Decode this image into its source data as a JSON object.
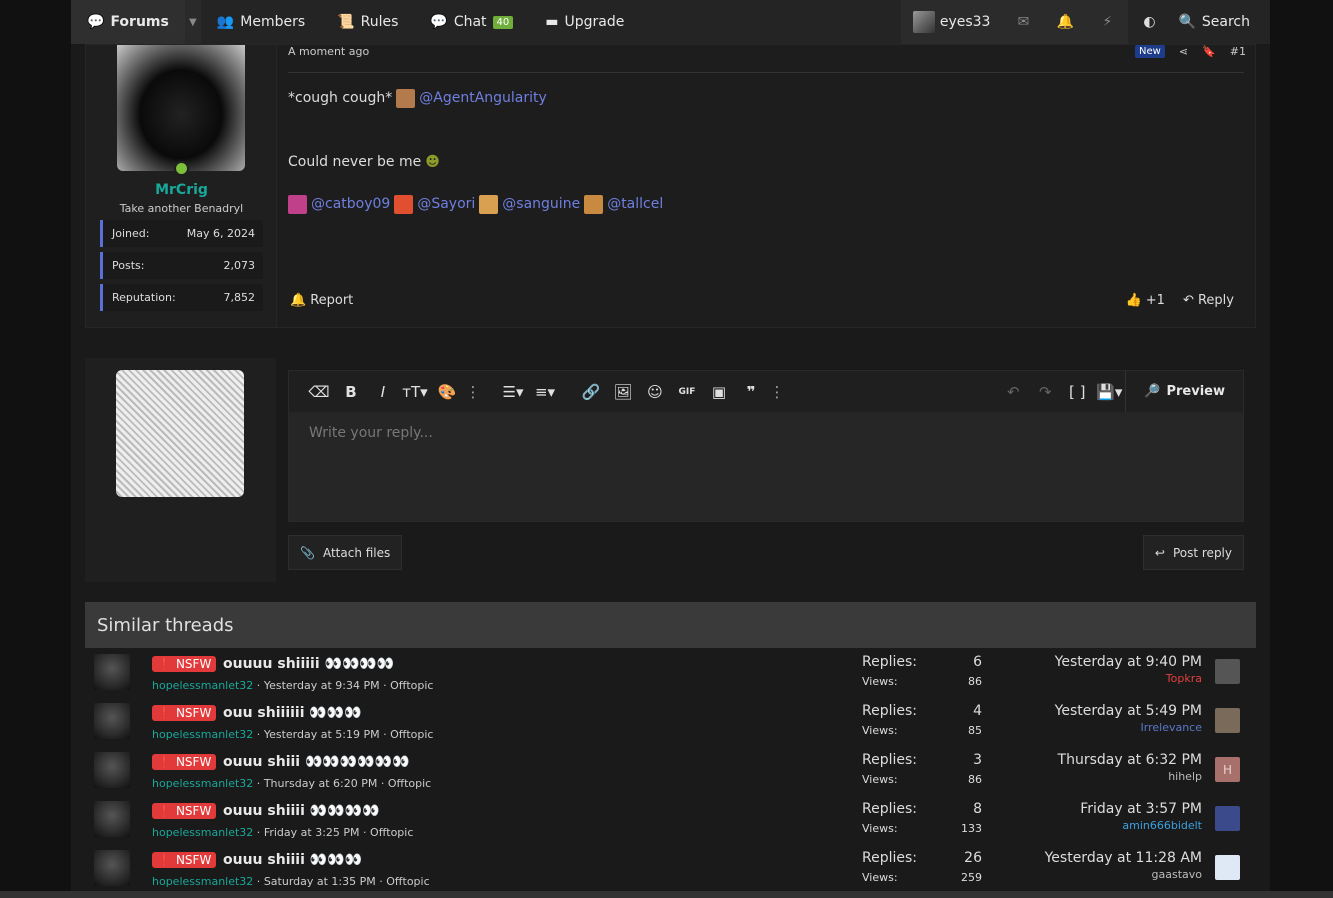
{
  "nav": {
    "forums": "Forums",
    "members": "Members",
    "rules": "Rules",
    "chat": "Chat",
    "chat_count": "40",
    "upgrade": "Upgrade",
    "user": "eyes33",
    "search": "Search"
  },
  "post": {
    "author": {
      "name": "MrCrig",
      "title": "Take another Benadryl",
      "stats": [
        {
          "label": "Joined:",
          "value": "May 6, 2024"
        },
        {
          "label": "Posts:",
          "value": "2,073"
        },
        {
          "label": "Reputation:",
          "value": "7,852"
        }
      ]
    },
    "time": "A moment ago",
    "badge": "New",
    "number": "#1",
    "line1_text": "*cough cough*",
    "line1_mention": "@AgentAngularity",
    "line2_text": "Could never be me",
    "mentions": [
      "@catboy09",
      "@Sayori",
      "@sanguine",
      "@tallcel"
    ],
    "report": "Report",
    "reactions": "+1",
    "reply": "Reply"
  },
  "editor": {
    "placeholder": "Write your reply...",
    "preview": "Preview",
    "attach": "Attach files",
    "post_reply": "Post reply"
  },
  "similar": {
    "heading": "Similar threads",
    "prefix": "NSFW",
    "replies_label": "Replies:",
    "views_label": "Views:",
    "rows": [
      {
        "title": "ouuuu shiiiii 👀👀👀👀",
        "author": "hopelessmanlet32",
        "date": "Yesterday at 9:34 PM",
        "forum": "Offtopic",
        "replies": "6",
        "views": "86",
        "last_date": "Yesterday at 9:40 PM",
        "last_user": "Topkra",
        "last_color": "#e04040"
      },
      {
        "title": "ouu shiiiiii 👀👀👀",
        "author": "hopelessmanlet32",
        "date": "Yesterday at 5:19 PM",
        "forum": "Offtopic",
        "replies": "4",
        "views": "85",
        "last_date": "Yesterday at 5:49 PM",
        "last_user": "Irrelevance",
        "last_color": "#5a78c8"
      },
      {
        "title": "ouuu shiii 👀👀👀👀👀👀",
        "author": "hopelessmanlet32",
        "date": "Thursday at 6:20 PM",
        "forum": "Offtopic",
        "replies": "3",
        "views": "86",
        "last_date": "Thursday at 6:32 PM",
        "last_user": "hihelp",
        "last_color": "#bbbbbb",
        "last_initial": "H"
      },
      {
        "title": "ouuu shiiii 👀👀👀👀",
        "author": "hopelessmanlet32",
        "date": "Friday at 3:25 PM",
        "forum": "Offtopic",
        "replies": "8",
        "views": "133",
        "last_date": "Friday at 3:57 PM",
        "last_user": "amin666bidelt",
        "last_color": "#3aa0e0"
      },
      {
        "title": "ouuu shiiii 👀👀👀",
        "author": "hopelessmanlet32",
        "date": "Saturday at 1:35 PM",
        "forum": "Offtopic",
        "replies": "26",
        "views": "259",
        "last_date": "Yesterday at 11:28 AM",
        "last_user": "gaastavo",
        "last_color": "#bbbbbb"
      }
    ]
  }
}
